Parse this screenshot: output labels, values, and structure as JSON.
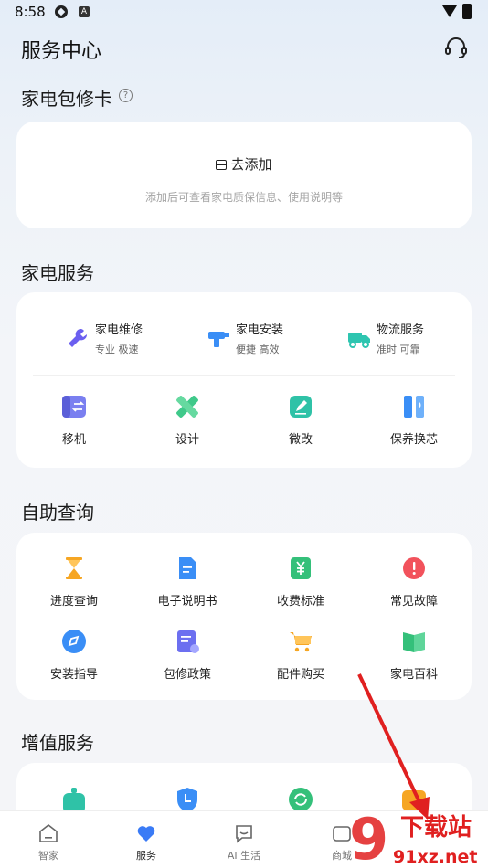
{
  "status_bar": {
    "time": "8:58",
    "icon_label": "A"
  },
  "header": {
    "title": "服务中心"
  },
  "warranty": {
    "title": "家电包修卡",
    "help": "?",
    "add_label": "去添加",
    "hint": "添加后可查看家电质保信息、使用说明等"
  },
  "appliance_service": {
    "title": "家电服务",
    "top_items": [
      {
        "title": "家电维修",
        "subtitle": "专业 极速",
        "icon": "wrench-icon"
      },
      {
        "title": "家电安装",
        "subtitle": "便捷 高效",
        "icon": "drill-icon"
      },
      {
        "title": "物流服务",
        "subtitle": "准时 可靠",
        "icon": "truck-icon"
      }
    ],
    "grid": [
      {
        "label": "移机",
        "icon": "move-icon"
      },
      {
        "label": "设计",
        "icon": "ruler-icon"
      },
      {
        "label": "微改",
        "icon": "edit-icon"
      },
      {
        "label": "保养换芯",
        "icon": "filter-icon"
      }
    ]
  },
  "self_service": {
    "title": "自助查询",
    "grid": [
      {
        "label": "进度查询",
        "icon": "hourglass-icon"
      },
      {
        "label": "电子说明书",
        "icon": "document-icon"
      },
      {
        "label": "收费标准",
        "icon": "yuan-icon"
      },
      {
        "label": "常见故障",
        "icon": "alert-icon"
      },
      {
        "label": "安装指导",
        "icon": "compass-icon"
      },
      {
        "label": "包修政策",
        "icon": "policy-icon"
      },
      {
        "label": "配件购买",
        "icon": "cart-icon"
      },
      {
        "label": "家电百科",
        "icon": "book-icon"
      }
    ]
  },
  "value_added": {
    "title": "增值服务"
  },
  "tabs": [
    {
      "label": "智家",
      "icon": "home-icon"
    },
    {
      "label": "服务",
      "icon": "heart-icon",
      "active": true
    },
    {
      "label": "AI 生活",
      "icon": "ai-chat-icon"
    },
    {
      "label": "商城",
      "icon": "shop-icon"
    }
  ],
  "watermark": {
    "text": "下载站",
    "url_text": "91xz.net",
    "logo": "9"
  },
  "colors": {
    "accent": "#3a7bf6",
    "arrow": "#e02020"
  }
}
